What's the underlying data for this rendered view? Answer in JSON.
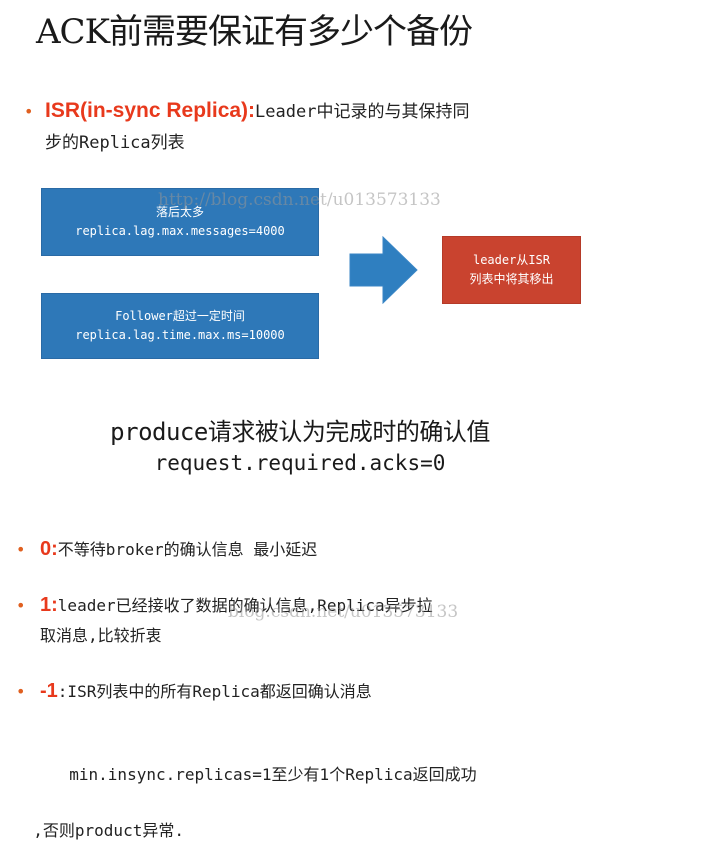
{
  "title": "ACK前需要保证有多少个备份",
  "isr": {
    "key": "ISR(in-sync Replica):",
    "desc_line1": "Leader中记录的与其保持同",
    "desc_line2": "步的Replica列表"
  },
  "diagram": {
    "box1_line1": "落后太多",
    "box1_line2": "replica.lag.max.messages=4000",
    "box2_line1": "Follower超过一定时间",
    "box2_line2": "replica.lag.time.max.ms=10000",
    "result_line1": "leader从ISR",
    "result_line2": "列表中将其移出",
    "arrow_icon": "right-arrow-icon",
    "colors": {
      "blue_box": "#2e78b8",
      "red_box": "#c9432f",
      "arrow": "#2f7fc0",
      "key_red": "#e8391c"
    }
  },
  "watermarks": {
    "wm1": "http://blog.csdn.net/u013573133",
    "wm2": "blog.csdn.net/u013573133"
  },
  "produce": {
    "line1": "produce请求被认为完成时的确认值",
    "line2": "request.required.acks=0"
  },
  "items": [
    {
      "key": "0:",
      "text": "不等待broker的确认信息  最小延迟"
    },
    {
      "key": "1:",
      "text_line1": "leader已经接收了数据的确认信息,Replica异步拉",
      "text_line2": "取消息,比较折衷"
    },
    {
      "key": "-1",
      "text": ":ISR列表中的所有Replica都返回确认消息"
    }
  ],
  "note": {
    "line1": "min.insync.replicas=1至少有1个Replica返回成功",
    "line2": ",否则product异常."
  }
}
